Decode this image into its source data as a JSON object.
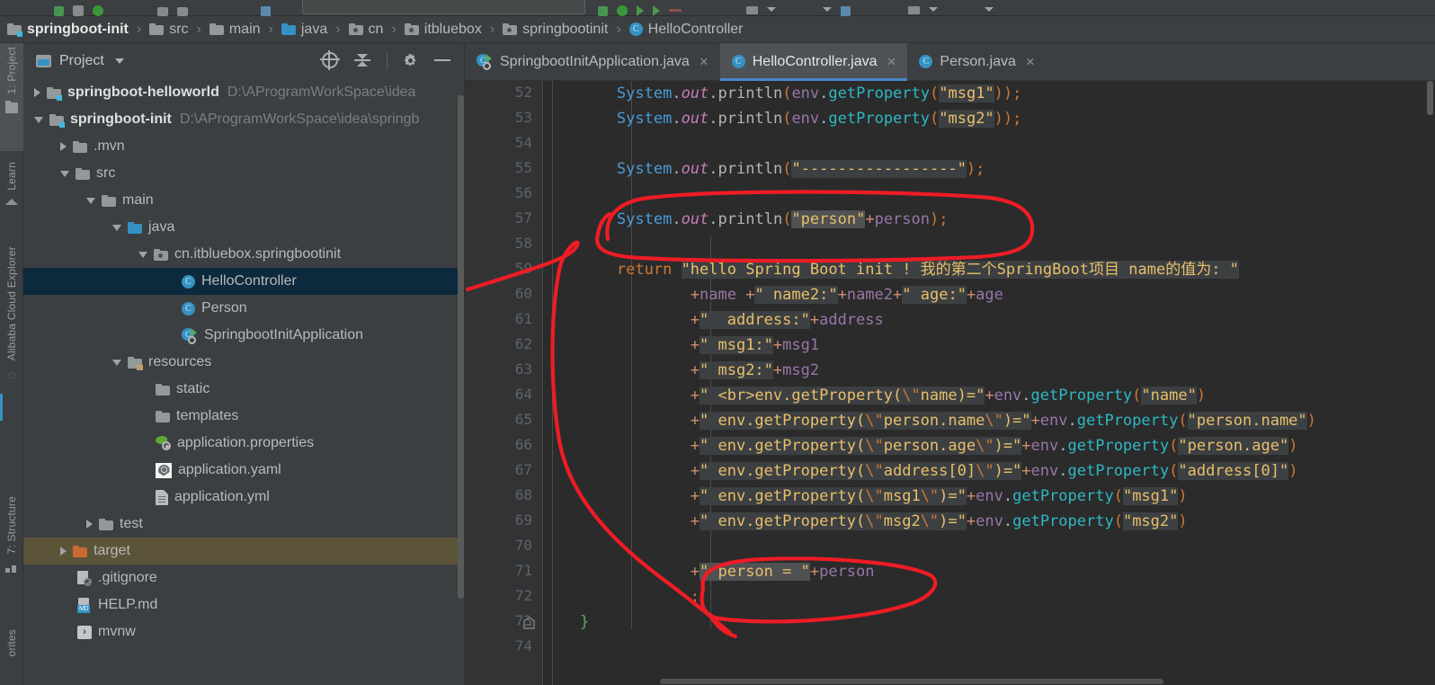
{
  "window": {
    "theme_bg": "#3c3f41",
    "editor_bg": "#2b2b2b",
    "accent": "#3592c4",
    "annotation_color": "#ee1c25"
  },
  "breadcrumb": {
    "name": "breadcrumb",
    "items": [
      {
        "label": "springboot-init",
        "icon": "module-folder-icon",
        "root": true
      },
      {
        "label": "src",
        "icon": "folder-icon"
      },
      {
        "label": "main",
        "icon": "folder-icon"
      },
      {
        "label": "java",
        "icon": "source-folder-icon"
      },
      {
        "label": "cn",
        "icon": "package-icon"
      },
      {
        "label": "itbluebox",
        "icon": "package-icon"
      },
      {
        "label": "springbootinit",
        "icon": "package-icon"
      },
      {
        "label": "HelloController",
        "icon": "java-class-icon"
      }
    ],
    "separator": "›"
  },
  "tool_strip": {
    "items": [
      {
        "label": "1: Project",
        "icon": "folder-icon",
        "active": true
      },
      {
        "label": "Learn",
        "icon": "learn-icon",
        "active": false
      },
      {
        "label": "Alibaba Cloud Explorer",
        "icon": "cloud-icon",
        "active": false
      },
      {
        "label": "7: Structure",
        "icon": "structure-icon",
        "active": false
      },
      {
        "label": "orites",
        "icon": "favorites-icon",
        "active": false
      }
    ]
  },
  "project_panel": {
    "title": "Project",
    "actions": [
      {
        "name": "select-opened-file-button",
        "icon": "target-icon"
      },
      {
        "name": "collapse-all-button",
        "icon": "collapse-all-icon"
      },
      {
        "name": "settings-button",
        "icon": "gear-icon"
      },
      {
        "name": "hide-button",
        "icon": "minus-icon"
      }
    ],
    "tree": [
      {
        "label": "springboot-helloworld",
        "path": "D:\\AProgramWorkSpace\\idea",
        "indent": 0,
        "arrow": "right",
        "icon": "module-folder-icon",
        "bold": true,
        "state": "normal"
      },
      {
        "label": "springboot-init",
        "path": "D:\\AProgramWorkSpace\\idea\\springb",
        "indent": 0,
        "arrow": "down",
        "icon": "module-folder-icon",
        "bold": true,
        "state": "normal"
      },
      {
        "label": ".mvn",
        "path": "",
        "indent": 1,
        "arrow": "right",
        "icon": "folder-icon",
        "bold": false,
        "state": "normal"
      },
      {
        "label": "src",
        "path": "",
        "indent": 1,
        "arrow": "down",
        "icon": "folder-icon",
        "bold": false,
        "state": "normal"
      },
      {
        "label": "main",
        "path": "",
        "indent": 2,
        "arrow": "down",
        "icon": "folder-icon",
        "bold": false,
        "state": "normal"
      },
      {
        "label": "java",
        "path": "",
        "indent": 3,
        "arrow": "down",
        "icon": "source-folder-icon",
        "bold": false,
        "state": "normal"
      },
      {
        "label": "cn.itbluebox.springbootinit",
        "path": "",
        "indent": 4,
        "arrow": "down",
        "icon": "package-icon",
        "bold": false,
        "state": "normal"
      },
      {
        "label": "HelloController",
        "path": "",
        "indent": 5,
        "arrow": "none",
        "icon": "java-class-icon",
        "bold": false,
        "state": "selected"
      },
      {
        "label": "Person",
        "path": "",
        "indent": 5,
        "arrow": "none",
        "icon": "java-class-icon",
        "bold": false,
        "state": "normal"
      },
      {
        "label": "SpringbootInitApplication",
        "path": "",
        "indent": 5,
        "arrow": "none",
        "icon": "spring-run-class-icon",
        "bold": false,
        "state": "normal"
      },
      {
        "label": "resources",
        "path": "",
        "indent": 3,
        "arrow": "down",
        "icon": "resources-folder-icon",
        "bold": false,
        "state": "normal"
      },
      {
        "label": "static",
        "path": "",
        "indent": 4,
        "arrow": "none",
        "icon": "folder-icon",
        "bold": false,
        "state": "normal"
      },
      {
        "label": "templates",
        "path": "",
        "indent": 4,
        "arrow": "none",
        "icon": "folder-icon",
        "bold": false,
        "state": "normal"
      },
      {
        "label": "application.properties",
        "path": "",
        "indent": 4,
        "arrow": "none",
        "icon": "spring-properties-icon",
        "bold": false,
        "state": "normal"
      },
      {
        "label": "application.yaml",
        "path": "",
        "indent": 4,
        "arrow": "none",
        "icon": "yaml-icon",
        "bold": false,
        "state": "normal"
      },
      {
        "label": "application.yml",
        "path": "",
        "indent": 4,
        "arrow": "none",
        "icon": "yml-file-icon",
        "bold": false,
        "state": "normal"
      },
      {
        "label": "test",
        "path": "",
        "indent": 2,
        "arrow": "right",
        "icon": "folder-icon",
        "bold": false,
        "state": "normal"
      },
      {
        "label": "target",
        "path": "",
        "indent": 1,
        "arrow": "right",
        "icon": "excluded-folder-icon",
        "bold": false,
        "state": "highlight"
      },
      {
        "label": ".gitignore",
        "path": "",
        "indent": 1,
        "arrow": "none",
        "icon": "gitignore-icon",
        "bold": false,
        "state": "normal"
      },
      {
        "label": "HELP.md",
        "path": "",
        "indent": 1,
        "arrow": "none",
        "icon": "markdown-icon",
        "bold": false,
        "state": "normal"
      },
      {
        "label": "mvnw",
        "path": "",
        "indent": 1,
        "arrow": "none",
        "icon": "shell-script-icon",
        "bold": false,
        "state": "normal"
      }
    ]
  },
  "editor": {
    "tabs": [
      {
        "label": "SpringbootInitApplication.java",
        "icon": "spring-run-class-icon",
        "active": false,
        "close": "×"
      },
      {
        "label": "HelloController.java",
        "icon": "java-class-icon",
        "active": true,
        "close": "×"
      },
      {
        "label": "Person.java",
        "icon": "java-class-icon",
        "active": false,
        "close": "×"
      }
    ],
    "line_numbers": [
      52,
      53,
      54,
      55,
      56,
      57,
      58,
      59,
      60,
      61,
      62,
      63,
      64,
      65,
      66,
      67,
      68,
      69,
      70,
      71,
      72,
      73,
      74
    ],
    "code_lines": [
      {
        "n": 52,
        "text": "        System.out.println(env.getProperty(\"msg1\"));"
      },
      {
        "n": 53,
        "text": "        System.out.println(env.getProperty(\"msg2\"));"
      },
      {
        "n": 54,
        "text": ""
      },
      {
        "n": 55,
        "text": "        System.out.println(\"-----------------\");"
      },
      {
        "n": 56,
        "text": ""
      },
      {
        "n": 57,
        "text": "        System.out.println(\"person\"+person);"
      },
      {
        "n": 58,
        "text": ""
      },
      {
        "n": 59,
        "text": "        return \"hello Spring Boot init ! 我的第二个SpringBoot项目 name的值为: \""
      },
      {
        "n": 60,
        "text": "                +name +\" name2:\"+name2+\" age:\"+age"
      },
      {
        "n": 61,
        "text": "                +\"  address:\"+address"
      },
      {
        "n": 62,
        "text": "                +\" msg1:\"+msg1"
      },
      {
        "n": 63,
        "text": "                +\" msg2:\"+msg2"
      },
      {
        "n": 64,
        "text": "                +\" <br>env.getProperty(\\\"name)=\"+env.getProperty(\"name\")"
      },
      {
        "n": 65,
        "text": "                +\" env.getProperty(\\\"person.name\\\")=\"+env.getProperty(\"person.name\")"
      },
      {
        "n": 66,
        "text": "                +\" env.getProperty(\\\"person.age\\\")=\"+env.getProperty(\"person.age\")"
      },
      {
        "n": 67,
        "text": "                +\" env.getProperty(\\\"address[0]\\\")=\"+env.getProperty(\"address[0]\")"
      },
      {
        "n": 68,
        "text": "                +\" env.getProperty(\\\"msg1\\\")=\"+env.getProperty(\"msg1\")"
      },
      {
        "n": 69,
        "text": "                +\" env.getProperty(\\\"msg2\\\")=\"+env.getProperty(\"msg2\")"
      },
      {
        "n": 70,
        "text": ""
      },
      {
        "n": 71,
        "text": "                +\" person = \"+person"
      },
      {
        "n": 72,
        "text": "                ;"
      },
      {
        "n": 73,
        "text": "    }"
      },
      {
        "n": 74,
        "text": ""
      }
    ]
  },
  "annotations": {
    "name": "red-ink-markup",
    "shapes": [
      {
        "type": "ellipse-around-line",
        "target_line": 57,
        "description": "hand-drawn red loop around System.out.println(\"person\"+person);"
      },
      {
        "type": "ellipse-around-line",
        "target_line": 71,
        "description": "hand-drawn red loop around +\" person = \"+person"
      },
      {
        "type": "connector",
        "from": "HelloController tree item",
        "to": "line 71 loop",
        "description": "long red curve linking the two loops"
      }
    ]
  }
}
